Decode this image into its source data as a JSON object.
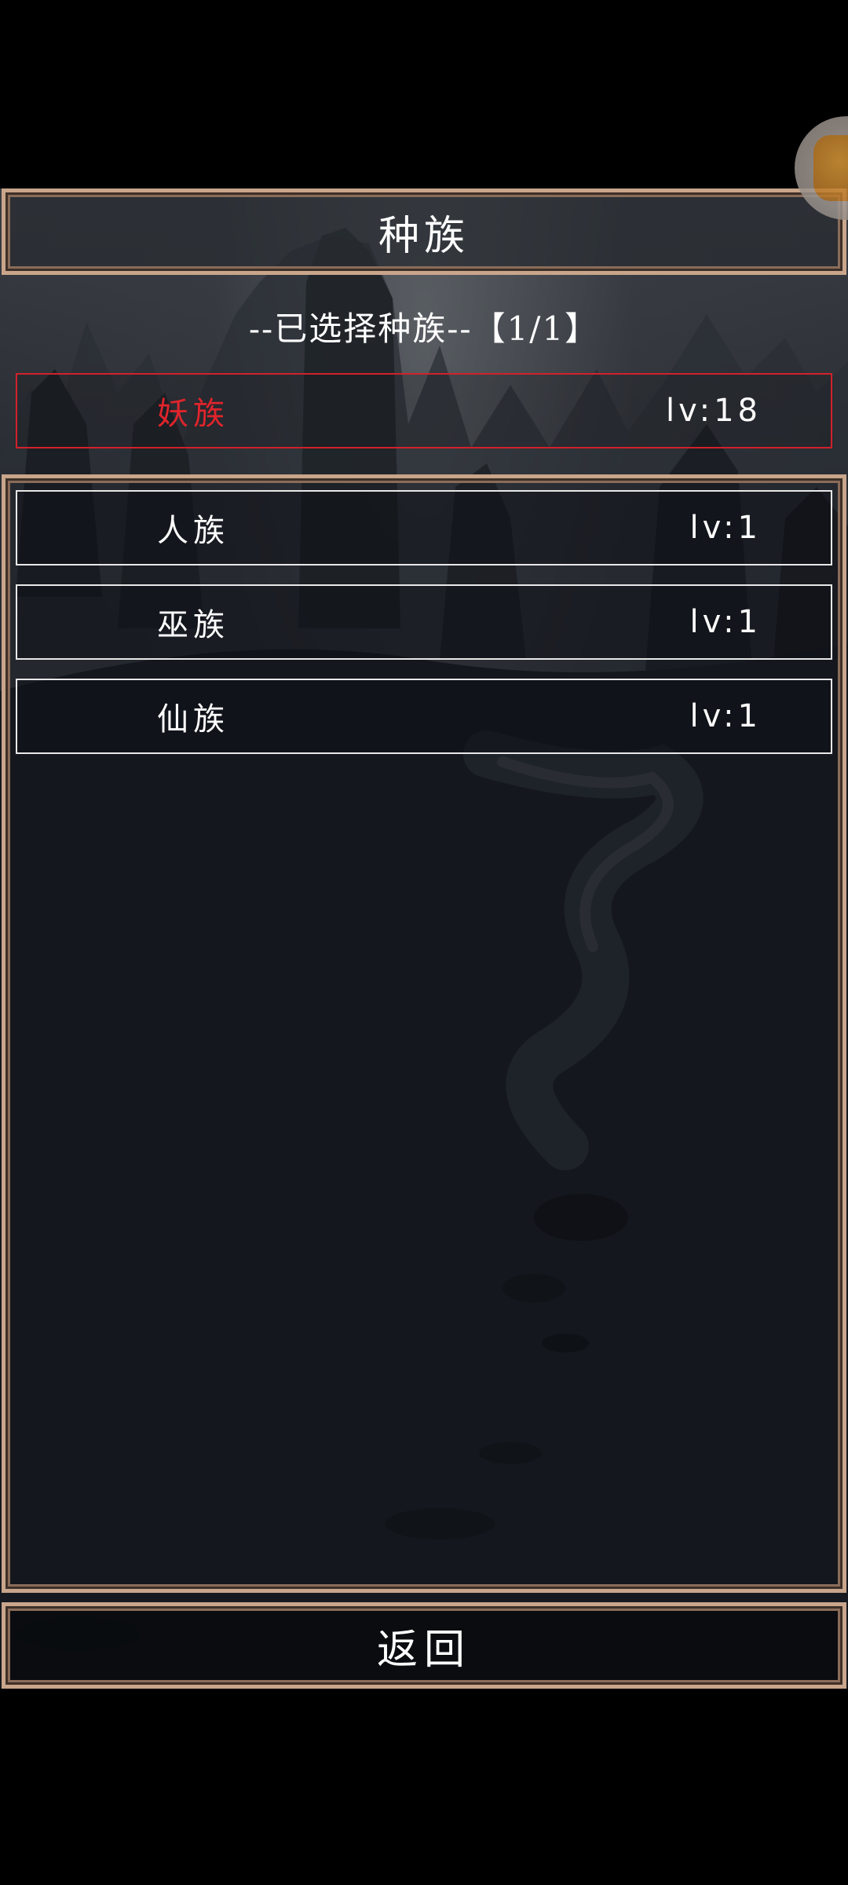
{
  "title": "种族",
  "selected_header": "--已选择种族--【1/1】",
  "selected_race": {
    "name": "妖族",
    "level": "lv:18"
  },
  "races": [
    {
      "name": "人族",
      "level": "lv:1"
    },
    {
      "name": "巫族",
      "level": "lv:1"
    },
    {
      "name": "仙族",
      "level": "lv:1"
    }
  ],
  "back_label": "返回",
  "colors": {
    "frame": "#c9a58b",
    "selected_accent": "#e0242c",
    "text": "#ffffff"
  }
}
